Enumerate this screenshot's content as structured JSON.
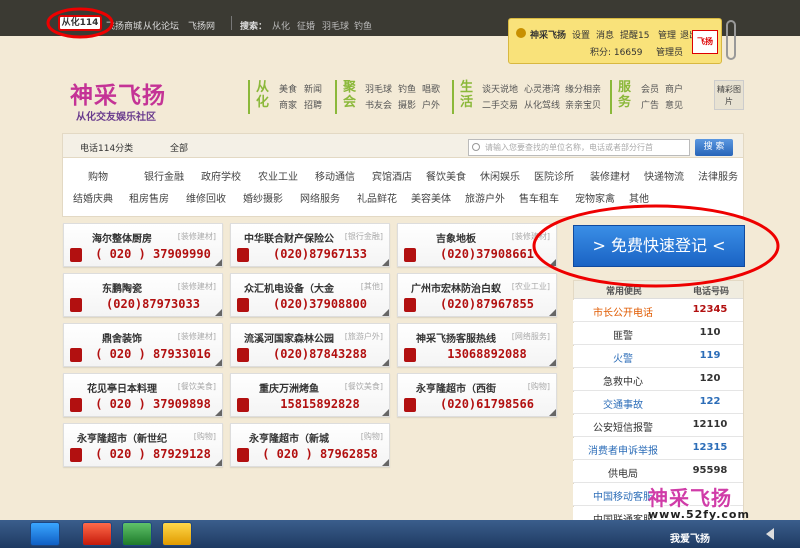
{
  "top_bar": {
    "site_tab": "从化114",
    "links": [
      "飞扬商城",
      "从化论坛",
      "飞扬网"
    ],
    "search_label": "搜索：",
    "search_links": [
      "从化",
      "征婚",
      "羽毛球",
      "钓鱼"
    ]
  },
  "user_panel": {
    "username": "神采飞扬",
    "links": [
      "设置",
      "消息",
      "提醒15",
      "管理",
      "退出"
    ],
    "points_label": "积分: 16659",
    "role": "管理员",
    "badge": "飞扬"
  },
  "logo": {
    "main": "神采飞扬",
    "sub": "从化交友娱乐社区"
  },
  "nav_groups": [
    {
      "title": "从化",
      "items": [
        "美食",
        "新闻",
        "商家",
        "招聘"
      ]
    },
    {
      "title": "聚会",
      "items": [
        "羽毛球",
        "钓鱼",
        "唱歌",
        "书友会",
        "摄影",
        "户外"
      ]
    },
    {
      "title": "生活",
      "items": [
        "谈天说地",
        "心灵港湾",
        "缘分相亲",
        "二手交易",
        "从化驾线",
        "亲亲宝贝"
      ]
    },
    {
      "title": "服务",
      "items": [
        "会员",
        "商户",
        "广告",
        "意见"
      ]
    }
  ],
  "nav_pics": "精彩图片",
  "directory": {
    "tab": "电话114分类",
    "all": "全部",
    "search_placeholder": "请输入您要查找的单位名称，电话或者部分行首",
    "search_button": "搜 索"
  },
  "categories": [
    [
      "购物",
      "银行金融",
      "政府学校",
      "农业工业",
      "移动通信",
      "宾馆酒店",
      "餐饮美食",
      "休闲娱乐",
      "医院诊所",
      "装修建材",
      "快递物流",
      "法律服务"
    ],
    [
      "结婚庆典",
      "租房售房",
      "维修回收",
      "婚纱摄影",
      "网络服务",
      "礼品鲜花",
      "美容美体",
      "旅游户外",
      "售车租车",
      "宠物家禽",
      "其他"
    ]
  ],
  "companies": [
    {
      "name": "海尔整体厨房",
      "cat": "[装修建材]",
      "phone": "( 020 ) 37909990"
    },
    {
      "name": "中华联合财产保险公",
      "cat": "[银行金融]",
      "phone": "(020)87967133"
    },
    {
      "name": "吉象地板",
      "cat": "[装修建材]",
      "phone": "(020)37908661"
    },
    {
      "name": "东鹏陶瓷",
      "cat": "[装修建材]",
      "phone": "(020)87973033"
    },
    {
      "name": "众汇机电设备（大金",
      "cat": "[其他]",
      "phone": "(020)37908800"
    },
    {
      "name": "广州市宏林防治白蚁",
      "cat": "[农业工业]",
      "phone": "(020)87967855"
    },
    {
      "name": "鼎舍装饰",
      "cat": "[装修建材]",
      "phone": "( 020 ) 87933016"
    },
    {
      "name": "流溪河国家森林公园",
      "cat": "[旅游户外]",
      "phone": "(020)87843288"
    },
    {
      "name": "神采飞扬客服热线",
      "cat": "[网络服务]",
      "phone": "13068892088"
    },
    {
      "name": "花见亭日本料理",
      "cat": "[餐饮美食]",
      "phone": "( 020 ) 37909898"
    },
    {
      "name": "重庆万洲烤鱼",
      "cat": "[餐饮美食]",
      "phone": "15815892828"
    },
    {
      "name": "永亨隆超市（西街",
      "cat": "[购物]",
      "phone": "(020)61798566"
    },
    {
      "name": "永亨隆超市（新世纪",
      "cat": "[购物]",
      "phone": "( 020 ) 87929128"
    },
    {
      "name": "永亨隆超市（新城",
      "cat": "[购物]",
      "phone": "( 020 ) 87962858"
    }
  ],
  "register_button": "> 免费快速登记 <",
  "services": {
    "headers": [
      "常用便民",
      "电话号码"
    ],
    "rows": [
      {
        "name": "市长公开电话",
        "val": "12345",
        "color": "#e05a00",
        "vcolor": "#b21010"
      },
      {
        "name": "匪警",
        "val": "110",
        "color": "#333",
        "vcolor": "#333"
      },
      {
        "name": "火警",
        "val": "119",
        "color": "#2c6db8",
        "vcolor": "#2c6db8"
      },
      {
        "name": "急救中心",
        "val": "120",
        "color": "#333",
        "vcolor": "#333"
      },
      {
        "name": "交通事故",
        "val": "122",
        "color": "#2c6db8",
        "vcolor": "#2c6db8"
      },
      {
        "name": "公安短信报警",
        "val": "12110",
        "color": "#333",
        "vcolor": "#333"
      },
      {
        "name": "消费者申诉举报",
        "val": "12315",
        "color": "#2c6db8",
        "vcolor": "#2c6db8"
      },
      {
        "name": "供电局",
        "val": "95598",
        "color": "#333",
        "vcolor": "#333"
      },
      {
        "name": "中国移动客服",
        "val": "",
        "color": "#2c6db8",
        "vcolor": "#333"
      },
      {
        "name": "中国联通客服",
        "val": "",
        "color": "#333",
        "vcolor": "#333"
      }
    ]
  },
  "watermark": {
    "text": "神采飞扬",
    "url": "www.52fy.com",
    "tray_text": "我爱飞扬"
  }
}
